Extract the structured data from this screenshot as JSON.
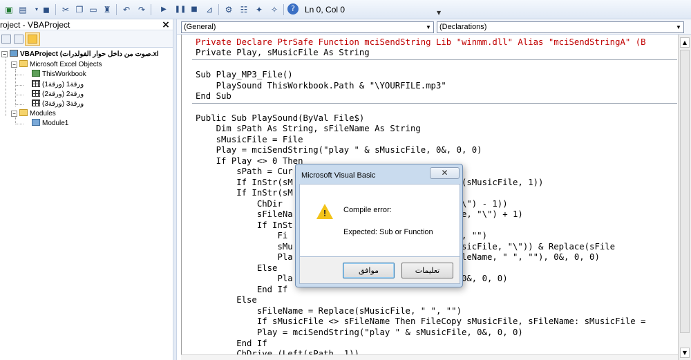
{
  "toolbar": {
    "status": "Ln 0, Col 0",
    "icons": [
      "excel-icon",
      "insert-userform-icon",
      "save-icon",
      "cut-icon",
      "copy-icon",
      "paste-icon",
      "find-icon",
      "undo-icon",
      "redo-icon",
      "run-icon",
      "break-icon",
      "reset-icon",
      "design-mode-icon",
      "project-explorer-icon",
      "properties-icon",
      "object-browser-icon",
      "toolbox-icon",
      "help-icon"
    ]
  },
  "project": {
    "title": "roject - VBAProject",
    "close": "×",
    "root": "VBAProject (صوت من داخل حوار الفولدرات.xl",
    "excel_objects": "Microsoft Excel Objects",
    "this_workbook": "ThisWorkbook",
    "sheets": [
      "ورقة1 (ورقة1)",
      "ورقة2 (ورقة2)",
      "ورقة3 (ورقة3)"
    ],
    "modules": "Modules",
    "module1": "Module1"
  },
  "code_window": {
    "object_combo": "(General)",
    "proc_combo": "(Declarations)",
    "lines": [
      "Private Declare PtrSafe Function mciSendString Lib \"winmm.dll\" Alias \"mciSendStringA\" (B",
      "Private Play, sMusicFile As String",
      "Sub Play_MP3_File()",
      "    PlaySound ThisWorkbook.Path & \"\\YOURFILE.mp3\"",
      "End Sub",
      "Public Sub PlaySound(ByVal File$)",
      "    Dim sPath As String, sFileName As String",
      "    sMusicFile = File",
      "    Play = mciSendString(\"play \" & sMusicFile, 0&, 0, 0)",
      "    If Play <> 0 Then",
      "        sPath = Cur",
      "        If InStr(sM                          e (Left(sMusicFile, 1))",
      "        If InStr(sM",
      "            ChDir                          icFile, \"\\\") - 1))",
      "            sFileNa                        sMusicFile, \"\\\") + 1)",
      "            If InSt",
      "                Fi                         Name, \" \", \"\")",
      "                sMu                        trRev(sMusicFile, \"\\\")) & Replace(sFile",
      "                Pla                        place(sFileName, \" \", \"\"), 0&, 0, 0)",
      "            Else",
      "                Pla                        ileName, 0&, 0, 0)",
      "            End If",
      "        Else",
      "            sFileName = Replace(sMusicFile, \" \", \"\")",
      "            If sMusicFile <> sFileName Then FileCopy sMusicFile, sFileName: sMusicFile =",
      "            Play = mciSendString(\"play \" & sMusicFile, 0&, 0, 0)",
      "        End If",
      "        ChDrive (Left(sPath, 1))"
    ]
  },
  "dialog": {
    "title": "Microsoft Visual Basic",
    "message_title": "Compile error:",
    "message_body": "Expected: Sub or Function",
    "ok_button": "موافق",
    "help_button": "تعليمات",
    "close_glyph": "✕",
    "warning_mark": "!"
  },
  "colors": {
    "toolbar_bg": "#dfe8f5",
    "code_red": "#c00000",
    "keyword_blue": "#00007f",
    "dialog_frame": "#c9dbee",
    "warning_yellow": "#f3c318"
  }
}
